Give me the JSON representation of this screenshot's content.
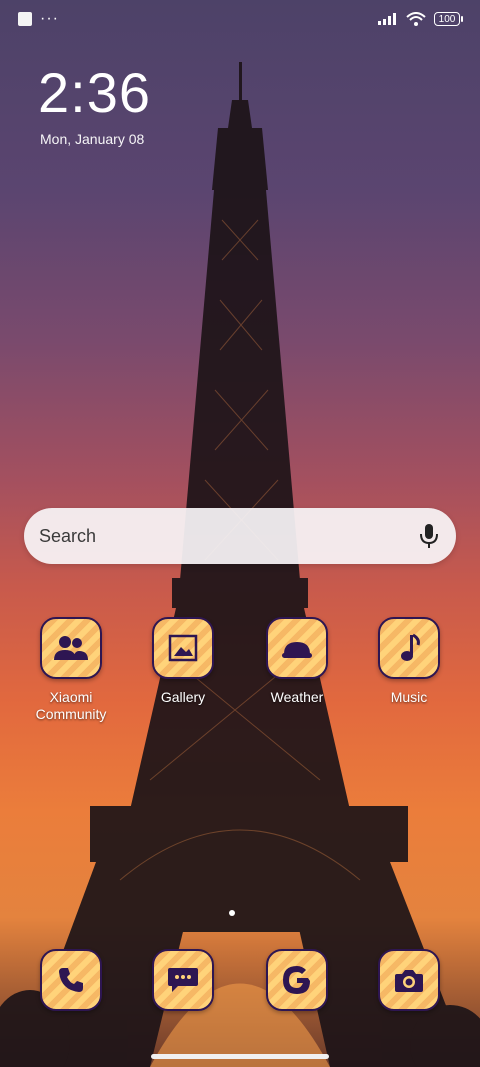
{
  "status_bar": {
    "left_icons": [
      "square-notification-icon",
      "more-dots-icon"
    ],
    "dots": "···",
    "right_icons": [
      "signal-icon",
      "wifi-icon",
      "battery-icon"
    ],
    "battery": "100"
  },
  "lockclock": {
    "time": "2:36",
    "date": "Mon, January 08"
  },
  "search": {
    "placeholder": "Search"
  },
  "apps": [
    {
      "label": "Xiaomi Community",
      "icon": "people-icon"
    },
    {
      "label": "Gallery",
      "icon": "picture-icon"
    },
    {
      "label": "Weather",
      "icon": "cloud-sun-icon"
    },
    {
      "label": "Music",
      "icon": "music-note-icon"
    }
  ],
  "dock": [
    {
      "icon": "phone-icon"
    },
    {
      "icon": "message-icon"
    },
    {
      "icon": "google-icon"
    },
    {
      "icon": "camera-icon"
    }
  ],
  "colors": {
    "icon_border": "#2e1652",
    "icon_fill": "#ffd37a"
  }
}
